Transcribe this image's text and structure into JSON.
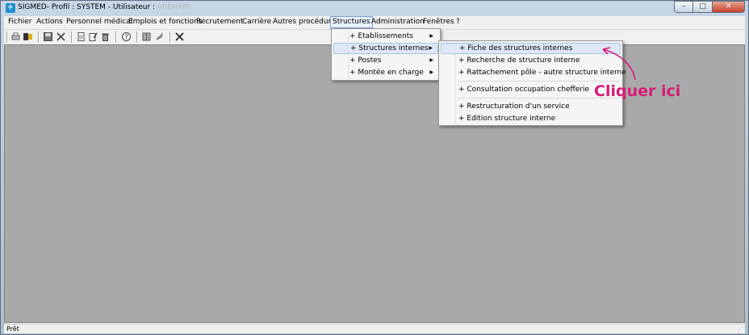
{
  "window": {
    "title": "SIGMED- Profil : SYSTEM - Utilisateur :",
    "title_redacted": "ARENAIR",
    "app_icon": "sigmed-app-icon",
    "controls": {
      "minimize": "–",
      "maximize": "□",
      "close": "✕"
    }
  },
  "menubar": {
    "items": [
      {
        "label": "Fichier"
      },
      {
        "label": "Actions"
      },
      {
        "label": "Personnel médical"
      },
      {
        "label": "Emplois et fonctions"
      },
      {
        "label": "Recrutement"
      },
      {
        "label": "Carrière"
      },
      {
        "label": "Autres procédures"
      },
      {
        "label": "Structures",
        "active": true
      },
      {
        "label": "Administration"
      },
      {
        "label": "Fenêtres"
      },
      {
        "label": "?"
      }
    ]
  },
  "toolbar": {
    "icons": [
      "print-icon",
      "export-icon",
      "save-icon",
      "delete-x-icon",
      "new-doc-icon",
      "edit-doc-icon",
      "trash-icon",
      "help-icon",
      "book-icon",
      "rocket-icon",
      "close-x-icon"
    ]
  },
  "structures_menu": {
    "items": [
      {
        "label": "+ Etablissements",
        "submenu": true
      },
      {
        "label": "+ Structures internes",
        "submenu": true,
        "highlighted": true
      },
      {
        "label": "+ Postes",
        "submenu": true
      },
      {
        "label": "+ Montée en charge",
        "submenu": true
      }
    ]
  },
  "structures_internes_menu": {
    "items": [
      {
        "label": "+ Fiche des structures internes",
        "highlighted": true
      },
      {
        "label": "+ Recherche de structure interne"
      },
      {
        "label": "+ Rattachement pôle - autre structure interne"
      },
      {
        "label": "+ Consultation occupation chefferie"
      },
      {
        "label": "+ Restructuration d'un service"
      },
      {
        "label": "+ Edition structure interne"
      }
    ]
  },
  "statusbar": {
    "text": "Prêt"
  },
  "annotation": {
    "text": "Cliquer ici",
    "color": "#d61c76"
  }
}
